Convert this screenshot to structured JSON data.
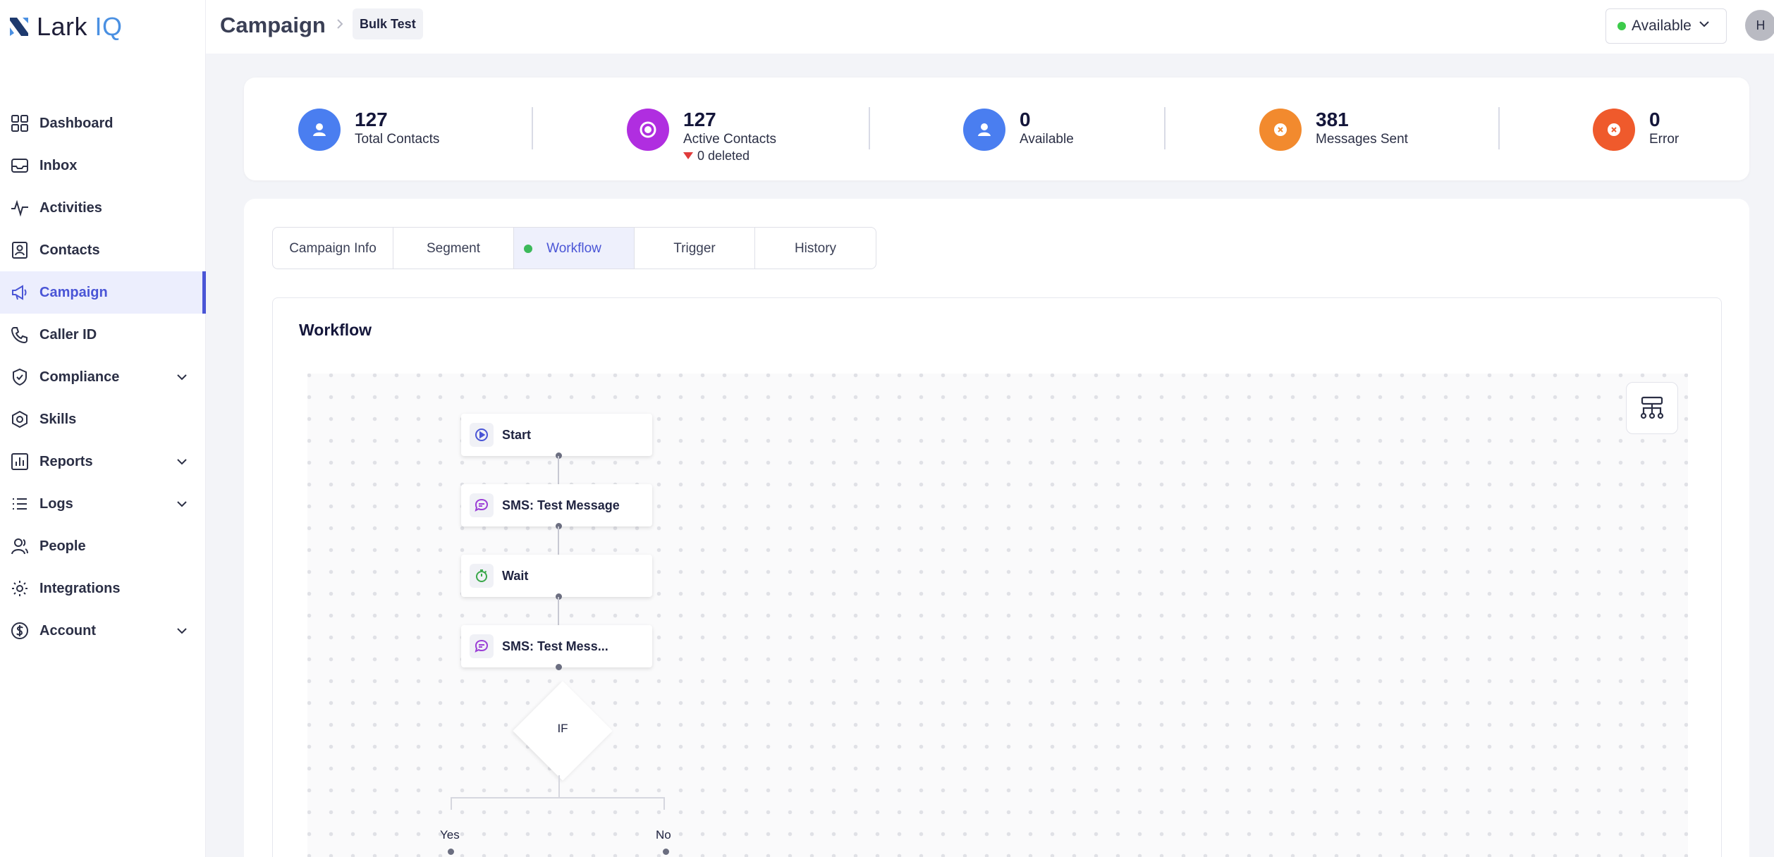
{
  "app": {
    "logo_text": "Lark",
    "logo_accent": "IQ"
  },
  "sidebar": {
    "items": [
      {
        "label": "Dashboard",
        "icon": "dashboard-icon"
      },
      {
        "label": "Inbox",
        "icon": "inbox-icon"
      },
      {
        "label": "Activities",
        "icon": "activity-icon"
      },
      {
        "label": "Contacts",
        "icon": "contacts-icon"
      },
      {
        "label": "Campaign",
        "icon": "megaphone-icon",
        "active": true
      },
      {
        "label": "Caller ID",
        "icon": "phone-icon"
      },
      {
        "label": "Compliance",
        "icon": "shield-check-icon",
        "expandable": true
      },
      {
        "label": "Skills",
        "icon": "hexagon-icon"
      },
      {
        "label": "Reports",
        "icon": "bar-chart-icon",
        "expandable": true
      },
      {
        "label": "Logs",
        "icon": "list-icon",
        "expandable": true
      },
      {
        "label": "People",
        "icon": "people-icon"
      },
      {
        "label": "Integrations",
        "icon": "gear-icon"
      },
      {
        "label": "Account",
        "icon": "dollar-icon",
        "expandable": true
      }
    ]
  },
  "header": {
    "title": "Campaign",
    "breadcrumb": "Bulk Test",
    "status": "Available",
    "avatar_initial": "H"
  },
  "stats": [
    {
      "value": "127",
      "label": "Total Contacts",
      "color": "#4a7ef0"
    },
    {
      "value": "127",
      "label": "Active Contacts",
      "sub": "0 deleted",
      "color": "#b02ee0"
    },
    {
      "value": "0",
      "label": "Available",
      "color": "#4a7ef0"
    },
    {
      "value": "381",
      "label": "Messages Sent",
      "color": "#f28a2e"
    },
    {
      "value": "0",
      "label": "Error",
      "color": "#ef5a2c"
    }
  ],
  "tabs": [
    {
      "label": "Campaign Info"
    },
    {
      "label": "Segment"
    },
    {
      "label": "Workflow",
      "active": true
    },
    {
      "label": "Trigger"
    },
    {
      "label": "History"
    }
  ],
  "workflow": {
    "title": "Workflow",
    "nodes": [
      {
        "label": "Start",
        "icon": "play-icon"
      },
      {
        "label": "SMS: Test Message",
        "icon": "chat-icon"
      },
      {
        "label": "Wait",
        "icon": "timer-icon"
      },
      {
        "label": "SMS: Test Mess...",
        "icon": "chat-icon"
      }
    ],
    "condition": "IF",
    "branch_yes": "Yes",
    "branch_no": "No"
  },
  "colors": {
    "accent": "#4a55d6",
    "status_green": "#3ccb4a"
  }
}
